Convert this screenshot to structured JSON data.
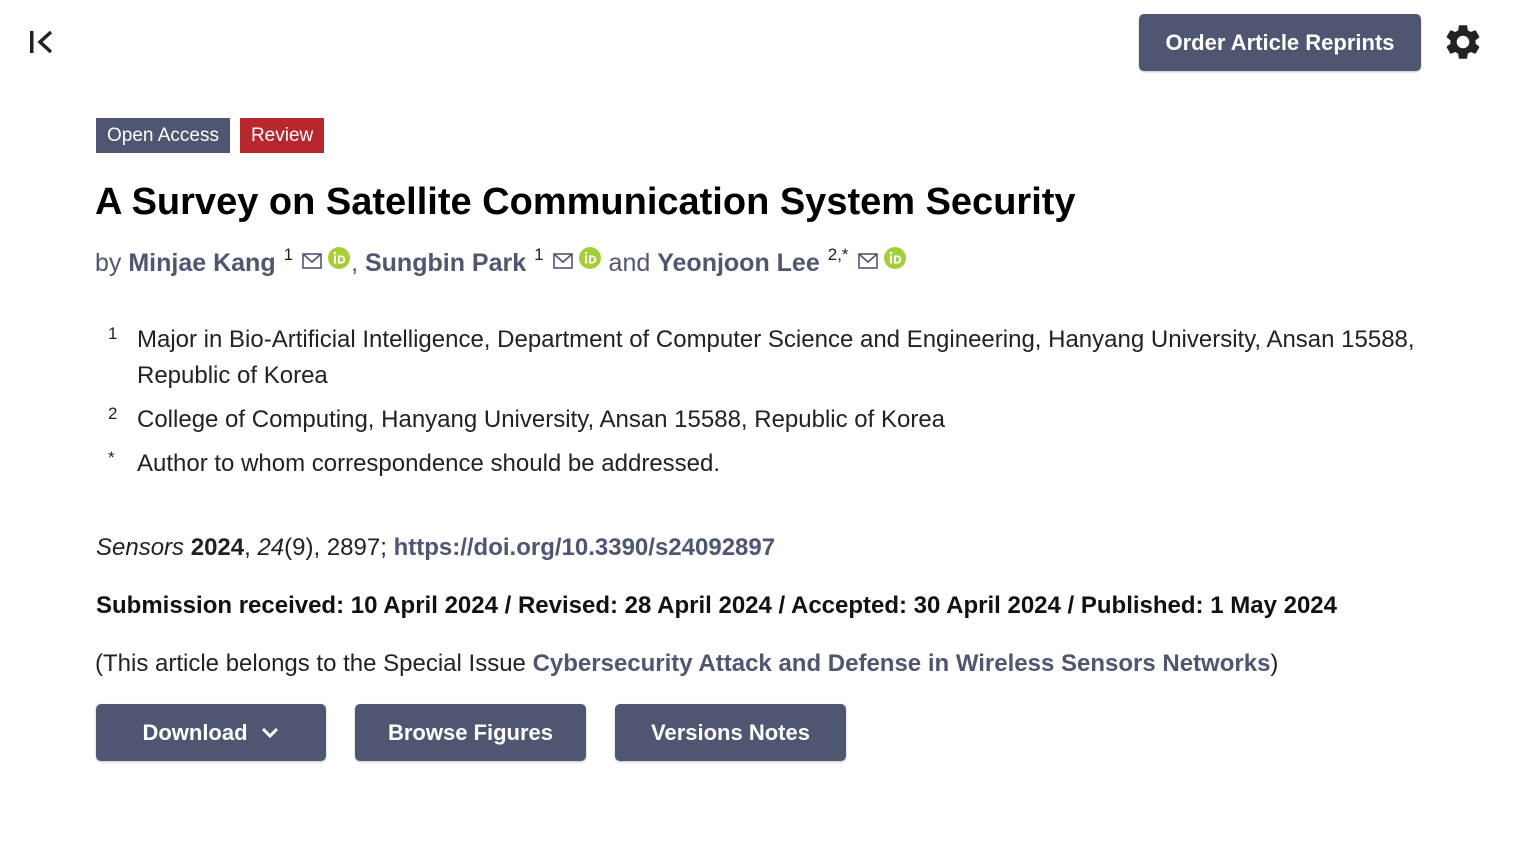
{
  "toolbar": {
    "collapse_icon": "collapse-left-icon",
    "reprints_label": "Order Article Reprints",
    "settings_icon": "gear-icon"
  },
  "badges": {
    "open_access": "Open Access",
    "review": "Review"
  },
  "article": {
    "title": "A Survey on Satellite Communication System Security",
    "by": "by",
    "authors": [
      {
        "name": "Minjae Kang",
        "affil": "1"
      },
      {
        "name": "Sungbin Park",
        "affil": "1"
      },
      {
        "name": "Yeonjoon Lee",
        "affil": "2,*"
      }
    ],
    "author_sep": ",",
    "author_and": "and",
    "affiliations": [
      {
        "num": "1",
        "text": "Major in Bio-Artificial Intelligence, Department of Computer Science and Engineering, Hanyang University, Ansan 15588, Republic of Korea"
      },
      {
        "num": "2",
        "text": "College of Computing, Hanyang University, Ansan 15588, Republic of Korea"
      },
      {
        "num": "*",
        "text": "Author to whom correspondence should be addressed."
      }
    ],
    "citation": {
      "journal": "Sensors",
      "year": "2024",
      "volume": "24",
      "issue": "(9)",
      "article_no": ", 2897; ",
      "doi": "https://doi.org/10.3390/s24092897"
    },
    "dates": "Submission received: 10 April 2024 / Revised: 28 April 2024 / Accepted: 30 April 2024 / Published: 1 May 2024",
    "special_issue": {
      "prefix": "(This article belongs to the Special Issue ",
      "link": "Cybersecurity Attack and Defense in Wireless Sensors Networks",
      "suffix": ")"
    }
  },
  "actions": {
    "download": "Download",
    "browse_figures": "Browse Figures",
    "versions_notes": "Versions Notes"
  },
  "colors": {
    "primary": "#4f5671",
    "review_badge": "#b7272e",
    "orcid": "#a6ce39"
  }
}
